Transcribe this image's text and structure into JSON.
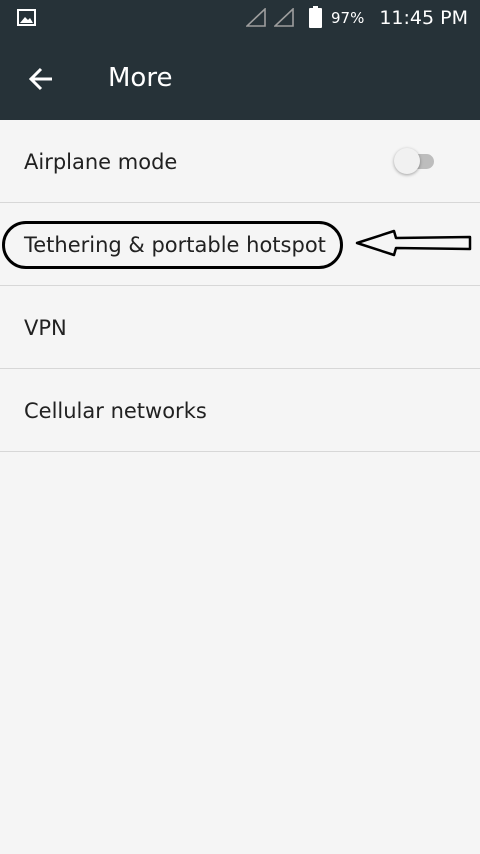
{
  "status_bar": {
    "gallery_icon": "image-icon",
    "signal_icons": [
      "signal-icon",
      "signal-icon"
    ],
    "battery_icon": "battery-icon",
    "battery_percent": "97%",
    "time": "11:45 PM"
  },
  "app_bar": {
    "back_icon": "arrow-back-icon",
    "title": "More"
  },
  "settings": {
    "items": [
      {
        "label": "Airplane mode",
        "has_toggle": true,
        "toggle_on": false
      },
      {
        "label": "Tethering & portable hotspot"
      },
      {
        "label": "VPN"
      },
      {
        "label": "Cellular networks"
      }
    ]
  },
  "annotation": {
    "highlighted_item": "Tethering & portable hotspot",
    "stroke_color": "#000000"
  },
  "colors": {
    "app_bar_bg": "#263238",
    "page_bg": "#f5f5f5",
    "divider": "#d7d7d7",
    "text_primary": "#212121"
  }
}
